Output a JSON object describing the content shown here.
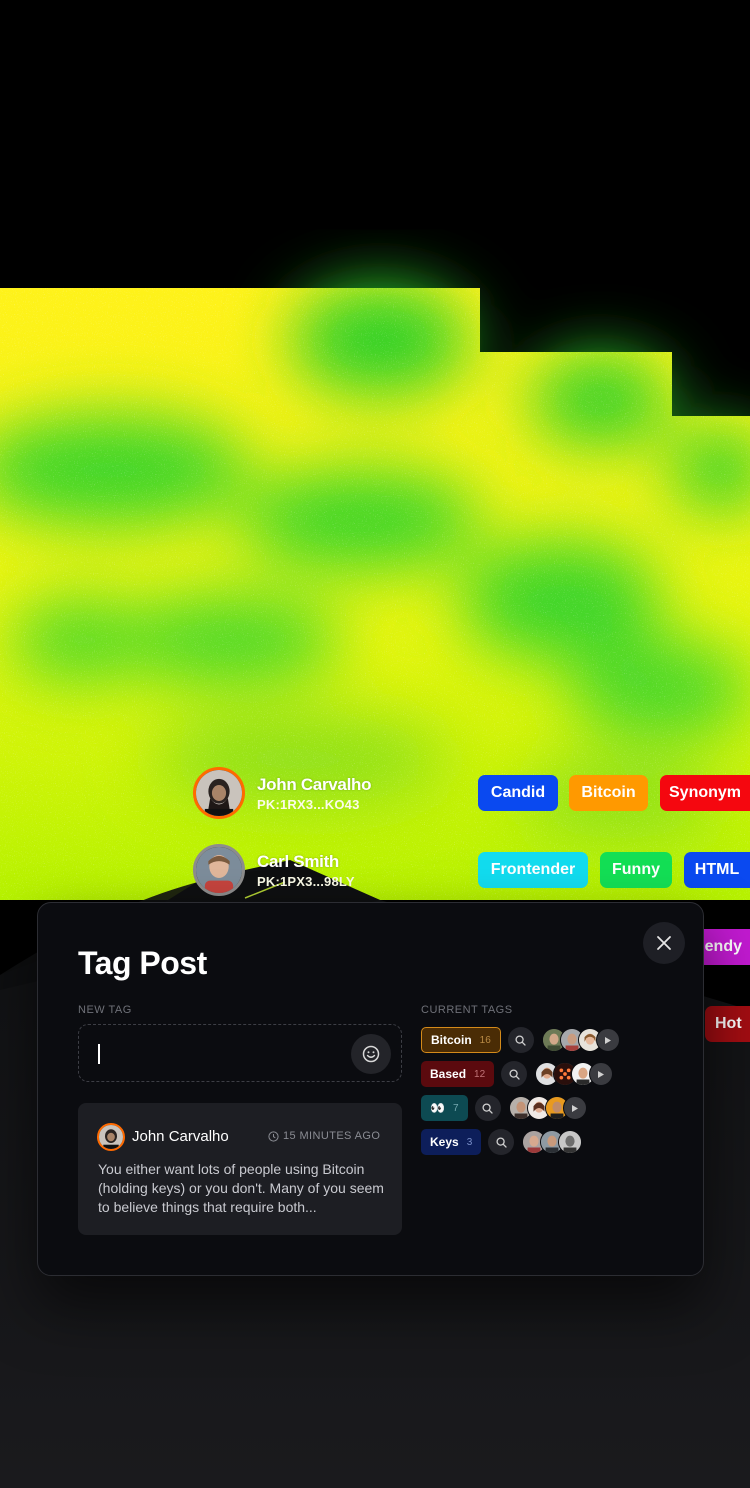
{
  "colors": {
    "accent_orange": "#ff6a00",
    "modal_bg": "#0b0c10",
    "card_bg": "#1d1e23"
  },
  "users": [
    {
      "name": "John Carvalho",
      "pk": "PK:1RX3...KO43"
    },
    {
      "name": "Carl Smith",
      "pk": "PK:1PX3...98LY"
    }
  ],
  "floating_tags": [
    {
      "label": "Candid",
      "color": "#0a49f0"
    },
    {
      "label": "Bitcoin",
      "color": "#ff9900"
    },
    {
      "label": "Synonym",
      "color": "#f5070f"
    },
    {
      "label": "Frontender",
      "color": "#12dcef"
    },
    {
      "label": "Funny",
      "color": "#13df55"
    },
    {
      "label": "HTML",
      "color": "#0a49f0"
    },
    {
      "label": "iendy",
      "color": "#c21ad1"
    },
    {
      "label": "Hot",
      "color": "#a30d12"
    }
  ],
  "modal": {
    "title": "Tag Post",
    "new_tag_label": "NEW TAG",
    "input_value": "",
    "current_tags_label": "CURRENT TAGS",
    "close_icon": "close-icon",
    "emoji_icon": "smiley-icon",
    "post": {
      "author": "John Carvalho",
      "time": "15 MINUTES AGO",
      "text": "You either want lots of people using Bitcoin (holding keys) or you don't. Many of you seem to believe things that require both..."
    },
    "current_tags": [
      {
        "label": "Bitcoin",
        "count": "16",
        "bg": "#4a2c05",
        "border": "#d48a1a",
        "countColor": "#b98a45"
      },
      {
        "label": "Based",
        "count": "12",
        "bg": "#5b0a0e",
        "border": "#5b0a0e",
        "countColor": "#c07377"
      },
      {
        "label": "👀",
        "count": "7",
        "bg": "#0d4a52",
        "border": "#0d4a52",
        "countColor": "#75a9b0"
      },
      {
        "label": "Keys",
        "count": "3",
        "bg": "#0d1e5a",
        "border": "#0d1e5a",
        "countColor": "#7a8fc9"
      }
    ]
  }
}
